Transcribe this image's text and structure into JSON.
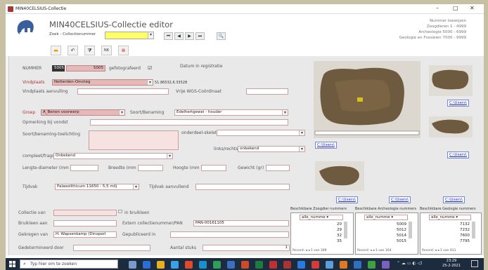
{
  "window": {
    "title": "MIN40CELSIUS-Collectie",
    "minimize": "–",
    "maximize": "□",
    "close": "✕"
  },
  "header": {
    "title": "MIN40CELSIUS-Collectie editor",
    "search_label": "Zoek - Collectienummer",
    "info": [
      "Nummer toewijzen",
      "Zoogdieren 1 - 4999",
      "Archeologie 5000 - 6999",
      "Geologie en Fossielen 7000 - 9999"
    ]
  },
  "nav": {
    "first": "⏮",
    "prev": "◀",
    "next": "▶",
    "last": "⏭",
    "binoculars": "🔍"
  },
  "toolbar": {
    "minus": "▬",
    "undo": "↶",
    "filter": "⧩",
    "nk": "NK",
    "stop": "⊗"
  },
  "form": {
    "nummer_label": "NUMMER",
    "nummer_small": "5005",
    "nummer_value": "5005",
    "gefotografeerd_label": "gefotografeerd",
    "gefotografeerd_check": "☑",
    "datum_label": "Datum in registratie",
    "vindplaats_label": "Vindplaats",
    "vindplaats_value": "Netterden-Omsteg",
    "coords": "51.86532,6.33528",
    "aanvulling_label": "Vindplaats aanvulling",
    "wgs_label": "Vrije WGS-Coördinaat",
    "groep_label": "Groep",
    "groep_value": "A_Benen voorwerp",
    "soort_label": "Soort/Benaming",
    "soort_value": "Edelhertgewei - houder",
    "opmerking_label": "Opmerking bij vondst",
    "toelichting_label": "Soort/benaming-toelichting",
    "onderdeel_label": "onderdeel-skelet",
    "linksrechts_label": "links/rechts",
    "linksrechts_value": "onbekend",
    "compleet_label": "compleet/fragment",
    "compleet_value": "Onbekend",
    "lengte_label": "Lengte-diameter (mm",
    "breedte_label": "Breedte (mm",
    "hoogte_label": "Hoogte (mm",
    "gewicht_label": "Gewicht (gr)",
    "tijdvak_label": "Tijdvak",
    "tijdvak_value": "Palaeolithicum 11650 - 5,5  milj",
    "tijdvak_aanv_label": "Tijdvak aanvullend",
    "collectie_label": "Collectie van",
    "bruikleen_check": "☐",
    "bruikleen_label": "in bruikleen",
    "bruikleen_aan_label": "Bruikleen aan",
    "extern_label": "Extern collectienummer/PAN",
    "extern_value": "PAN-00161105",
    "gekregen_label": "Gekregen van",
    "gekregen_value": "H. Wapsenkamp (Dinxperl",
    "gepubliceerd_label": "Gepubliceerd in",
    "gedetermineerd_label": "Gedetermineerd door",
    "aantal_label": "Aantal stuks",
    "aantal_value": "1"
  },
  "photo_links": [
    "C:\\Users\\",
    "C:\\Users\\",
    "C:\\Users\\",
    "C:\\Users\\",
    "C:\\Users\\",
    "C:\\Users\\"
  ],
  "lists": [
    {
      "header": "Beschikbare Zoogdier nummers",
      "filter": "alle_numme ▾",
      "rows": [
        "20",
        "29",
        "32",
        "35"
      ],
      "record": "Record: ◂ ◂ 1 van 309"
    },
    {
      "header": "Beschikbare Archeologie nummers",
      "filter": "alle_numme ▾",
      "rows": [
        "5009",
        "5012",
        "5014",
        "5015"
      ],
      "record": "Record: ◂ ◂ 1 van 164"
    },
    {
      "header": "Beschikbare Geologie nummers",
      "filter": "alle_numme ▾",
      "rows": [
        "7132",
        "7232",
        "7600",
        "7795"
      ],
      "record": "Record: ◂ ◂ 1 van 911"
    }
  ],
  "taskbar": {
    "search": "Typ hier om te zoeken",
    "time": "23:29",
    "date": "25-2-2021"
  }
}
